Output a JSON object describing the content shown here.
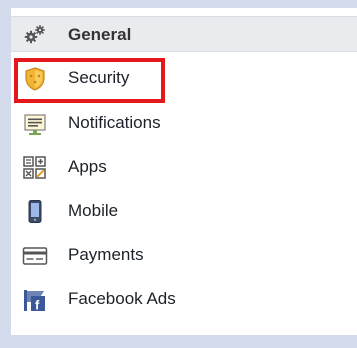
{
  "header": {
    "title": "General",
    "icon": "gears-icon"
  },
  "items": [
    {
      "label": "Security",
      "icon": "shield-icon"
    },
    {
      "label": "Notifications",
      "icon": "notification-screen-icon"
    },
    {
      "label": "Apps",
      "icon": "apps-grid-icon"
    },
    {
      "label": "Mobile",
      "icon": "mobile-phone-icon"
    },
    {
      "label": "Payments",
      "icon": "credit-card-icon"
    },
    {
      "label": "Facebook Ads",
      "icon": "ads-flag-icon"
    }
  ],
  "highlight": {
    "color": "#e3171c",
    "target": "Security"
  },
  "colors": {
    "header_bg": "#e9ebee",
    "chrome": "#d3dbec",
    "text": "#1d2129"
  }
}
